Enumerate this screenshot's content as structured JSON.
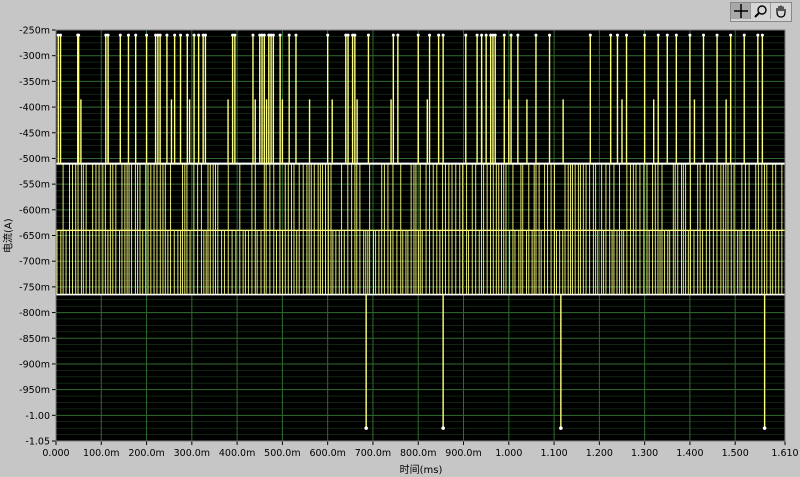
{
  "toolbar": {
    "tools": [
      {
        "name": "crosshair-tool",
        "icon": "crosshair-icon",
        "active": true
      },
      {
        "name": "zoom-tool",
        "icon": "zoom-icon",
        "active": false
      },
      {
        "name": "pan-tool",
        "icon": "hand-icon",
        "active": false
      }
    ]
  },
  "chart_data": {
    "type": "line",
    "xlabel": "时间(ms)",
    "ylabel": "电流(A)",
    "xlim": [
      0,
      1.61
    ],
    "ylim": [
      -1.05,
      -0.25
    ],
    "x_ticks": [
      0,
      0.1,
      0.2,
      0.3,
      0.4,
      0.5,
      0.6,
      0.7,
      0.8,
      0.9,
      1.0,
      1.1,
      1.2,
      1.3,
      1.4,
      1.5,
      1.61
    ],
    "x_tick_labels": [
      "0.000",
      "100.0m",
      "200.0m",
      "300.0m",
      "400.0m",
      "500.0m",
      "600.0m",
      "700.0m",
      "800.0m",
      "900.0m",
      "1.000",
      "1.100",
      "1.200",
      "1.300",
      "1.400",
      "1.500",
      "1.610"
    ],
    "y_ticks": [
      -0.25,
      -0.3,
      -0.35,
      -0.4,
      -0.45,
      -0.5,
      -0.55,
      -0.6,
      -0.65,
      -0.7,
      -0.75,
      -0.8,
      -0.85,
      -0.9,
      -0.95,
      -1.0,
      -1.05
    ],
    "y_tick_labels": [
      "-250m",
      "-300m",
      "-350m",
      "-400m",
      "-450m",
      "-500m",
      "-550m",
      "-600m",
      "-650m",
      "-700m",
      "-750m",
      "-800m",
      "-850m",
      "-900m",
      "-950m",
      "-1.00",
      "-1.05"
    ],
    "grid": true,
    "colors": {
      "background": "#000000",
      "grid": "#2f6b2f",
      "trace": "#ffff80",
      "levels": "#ffffff"
    },
    "series": [
      {
        "levels": [
          -0.26,
          -0.51,
          -0.765
        ],
        "upper_spikes_x": [
          0.005,
          0.01,
          0.048,
          0.05,
          0.11,
          0.115,
          0.142,
          0.16,
          0.176,
          0.2,
          0.22,
          0.225,
          0.23,
          0.245,
          0.262,
          0.275,
          0.29,
          0.305,
          0.315,
          0.325,
          0.33,
          0.39,
          0.395,
          0.435,
          0.45,
          0.455,
          0.46,
          0.47,
          0.475,
          0.48,
          0.495,
          0.515,
          0.53,
          0.6,
          0.64,
          0.645,
          0.655,
          0.66,
          0.69,
          0.745,
          0.755,
          0.8,
          0.825,
          0.845,
          0.855,
          0.905,
          0.93,
          0.94,
          0.95,
          0.96,
          0.965,
          0.97,
          0.99,
          1.005,
          1.02,
          1.06,
          1.09,
          1.18,
          1.225,
          1.24,
          1.26,
          1.3,
          1.33,
          1.35,
          1.37,
          1.4,
          1.43,
          1.46,
          1.49,
          1.52,
          1.55,
          1.56
        ],
        "mid_spikes_x": [
          0.055,
          0.115,
          0.255,
          0.295,
          0.38,
          0.44,
          0.465,
          0.5,
          0.56,
          0.61,
          0.665,
          0.74,
          0.8,
          0.82,
          0.94,
          1.0,
          1.04,
          1.12,
          1.25,
          1.32,
          1.41,
          1.48,
          1.55
        ],
        "lower_spikes": [
          {
            "x": 0.685,
            "y": -1.025
          },
          {
            "x": 0.855,
            "y": -1.025
          },
          {
            "x": 1.115,
            "y": -1.025
          },
          {
            "x": 1.565,
            "y": -1.025
          }
        ]
      }
    ]
  }
}
